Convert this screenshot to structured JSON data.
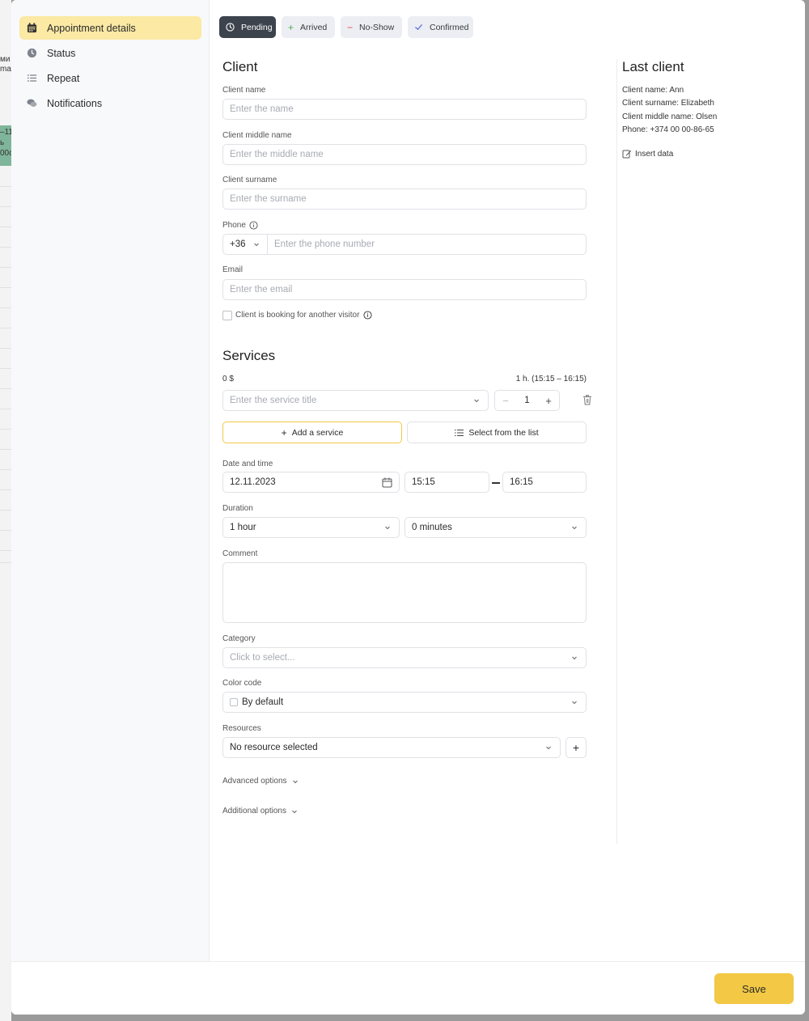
{
  "background": {
    "texts": [
      "ми",
      "ma",
      "–11",
      "ь",
      "00с"
    ]
  },
  "sidebar": {
    "items": [
      {
        "label": "Appointment details",
        "icon": "calendar-icon",
        "active": true
      },
      {
        "label": "Status",
        "icon": "clock-icon",
        "active": false
      },
      {
        "label": "Repeat",
        "icon": "list-icon",
        "active": false
      },
      {
        "label": "Notifications",
        "icon": "chat-icon",
        "active": false
      }
    ]
  },
  "statuses": [
    {
      "label": "Pending",
      "icon": "clock-icon",
      "active": true
    },
    {
      "label": "Arrived",
      "icon": "plus-icon",
      "color": "#4caf50"
    },
    {
      "label": "No-Show",
      "icon": "minus-icon",
      "color": "#e5484d"
    },
    {
      "label": "Confirmed",
      "icon": "check-icon",
      "color": "#5b6ee1"
    }
  ],
  "client": {
    "heading": "Client",
    "name_label": "Client name",
    "name_placeholder": "Enter the name",
    "middle_label": "Client middle name",
    "middle_placeholder": "Enter the middle name",
    "surname_label": "Client surname",
    "surname_placeholder": "Enter the surname",
    "phone_label": "Phone",
    "phone_code": "+36",
    "phone_placeholder": "Enter the phone number",
    "email_label": "Email",
    "email_placeholder": "Enter the email",
    "another_visitor_label": "Client is booking for another visitor"
  },
  "services": {
    "heading": "Services",
    "total": "0 $",
    "duration_summary": "1 h. (15:15 – 16:15)",
    "title_placeholder": "Enter the service title",
    "quantity": "1",
    "add_label": "Add a service",
    "select_label": "Select from the list"
  },
  "datetime": {
    "label": "Date and time",
    "date": "12.11.2023",
    "start": "15:15",
    "end": "16:15"
  },
  "duration": {
    "label": "Duration",
    "hours": "1 hour",
    "minutes": "0 minutes"
  },
  "comment": {
    "label": "Comment"
  },
  "category": {
    "label": "Category",
    "placeholder": "Click to select..."
  },
  "color_code": {
    "label": "Color code",
    "value": "By default"
  },
  "resources": {
    "label": "Resources",
    "value": "No resource selected"
  },
  "advanced_label": "Advanced options",
  "additional_label": "Additional options",
  "last_client": {
    "heading": "Last client",
    "lines": [
      "Client name: Ann",
      "Client surname: Elizabeth",
      "Client middle name: Olsen",
      "Phone: +374 00 00-86-65"
    ],
    "insert_label": "Insert data"
  },
  "footer": {
    "save_label": "Save"
  }
}
